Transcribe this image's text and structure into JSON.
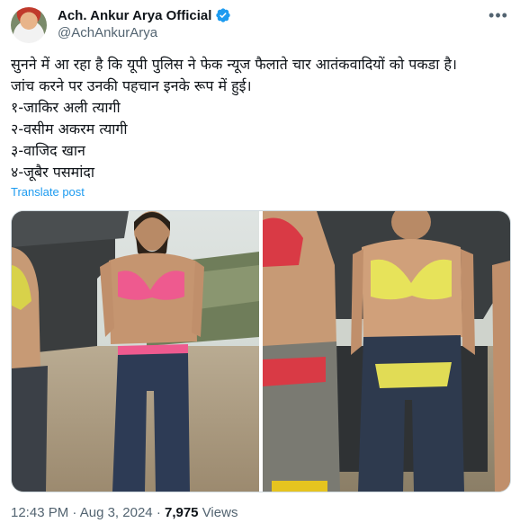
{
  "post": {
    "display_name": "Ach. Ankur Arya Official",
    "handle": "@AchAnkurArya",
    "verified_icon": "verified-badge-icon",
    "more_icon": "more-options-icon",
    "text_lines": [
      "सुनने में आ रहा है कि यूपी पुलिस ने फेक न्यूज फैलाते चार आतंकवादियों को पकडा है।",
      "जांच करने पर उनकी पहचान इनके रूप में हुई।",
      "१-जाकिर अली त्यागी",
      "२-वसीम अकरम त्यागी",
      "३-वाजिद खान",
      "४-जूबैर पसमांदा"
    ],
    "translate_label": "Translate post",
    "time": "12:43 PM",
    "separator": "·",
    "date": "Aug 3, 2024",
    "views_count": "7,975",
    "views_label": "Views"
  },
  "colors": {
    "verified": "#1d9bf0",
    "link": "#1d9bf0",
    "secondary_text": "#536471"
  }
}
